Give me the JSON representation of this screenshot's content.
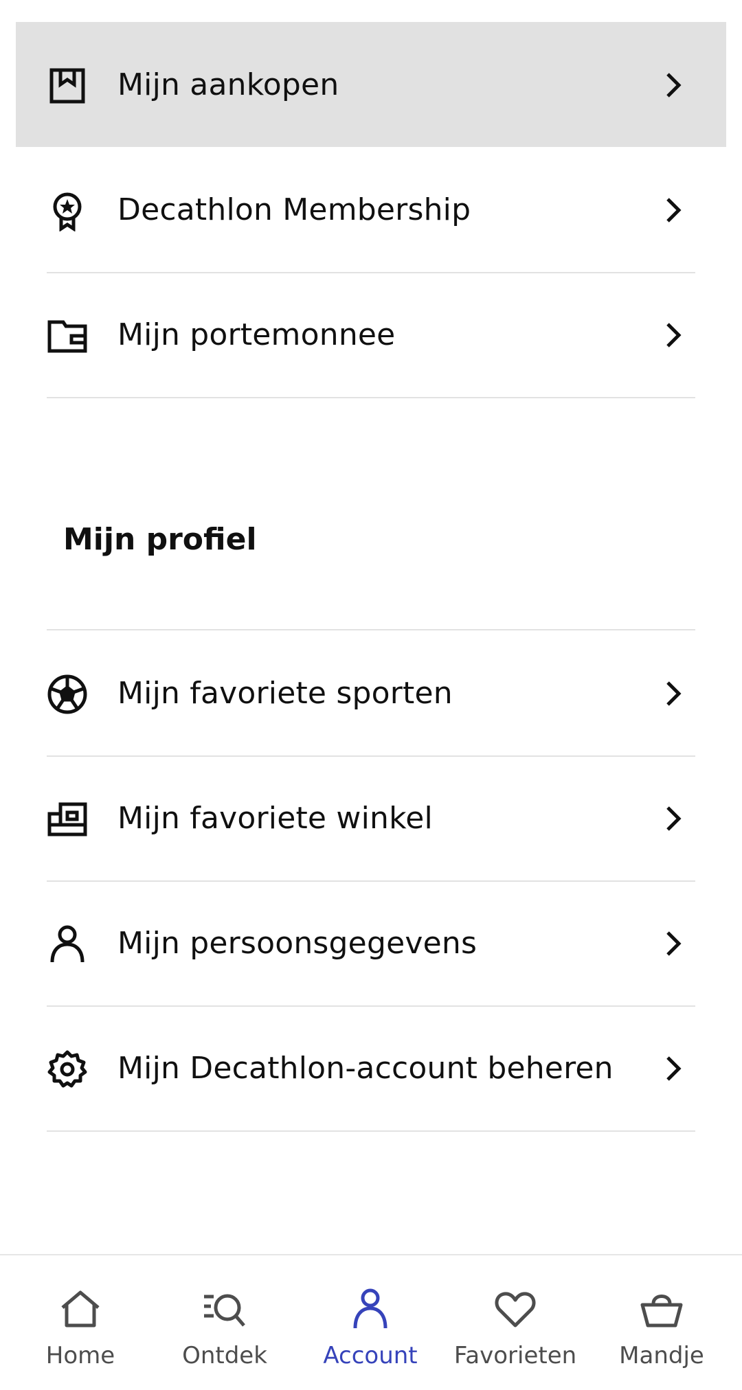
{
  "account_menu": {
    "items": [
      {
        "label": "Mijn aankopen",
        "icon": "receipt-bookmark-icon",
        "active": true
      },
      {
        "label": "Decathlon Membership",
        "icon": "award-ribbon-icon"
      },
      {
        "label": "Mijn portemonnee",
        "icon": "wallet-icon"
      }
    ]
  },
  "profile": {
    "section_title": "Mijn profiel",
    "items": [
      {
        "label": "Mijn favoriete sporten",
        "icon": "soccer-ball-icon"
      },
      {
        "label": "Mijn favoriete winkel",
        "icon": "store-icon"
      },
      {
        "label": "Mijn persoonsgegevens",
        "icon": "user-icon"
      },
      {
        "label": "Mijn Decathlon-account beheren",
        "icon": "gear-icon"
      }
    ]
  },
  "bottom_nav": {
    "active": "Account",
    "active_color": "#3643ba",
    "items": [
      {
        "label": "Home",
        "icon": "home-icon"
      },
      {
        "label": "Ontdek",
        "icon": "search-list-icon"
      },
      {
        "label": "Account",
        "icon": "user-icon"
      },
      {
        "label": "Favorieten",
        "icon": "heart-icon"
      },
      {
        "label": "Mandje",
        "icon": "basket-icon"
      }
    ]
  },
  "colors": {
    "highlight": "#e1e1e1",
    "divider": "#e2e2e2",
    "text": "#101010"
  }
}
